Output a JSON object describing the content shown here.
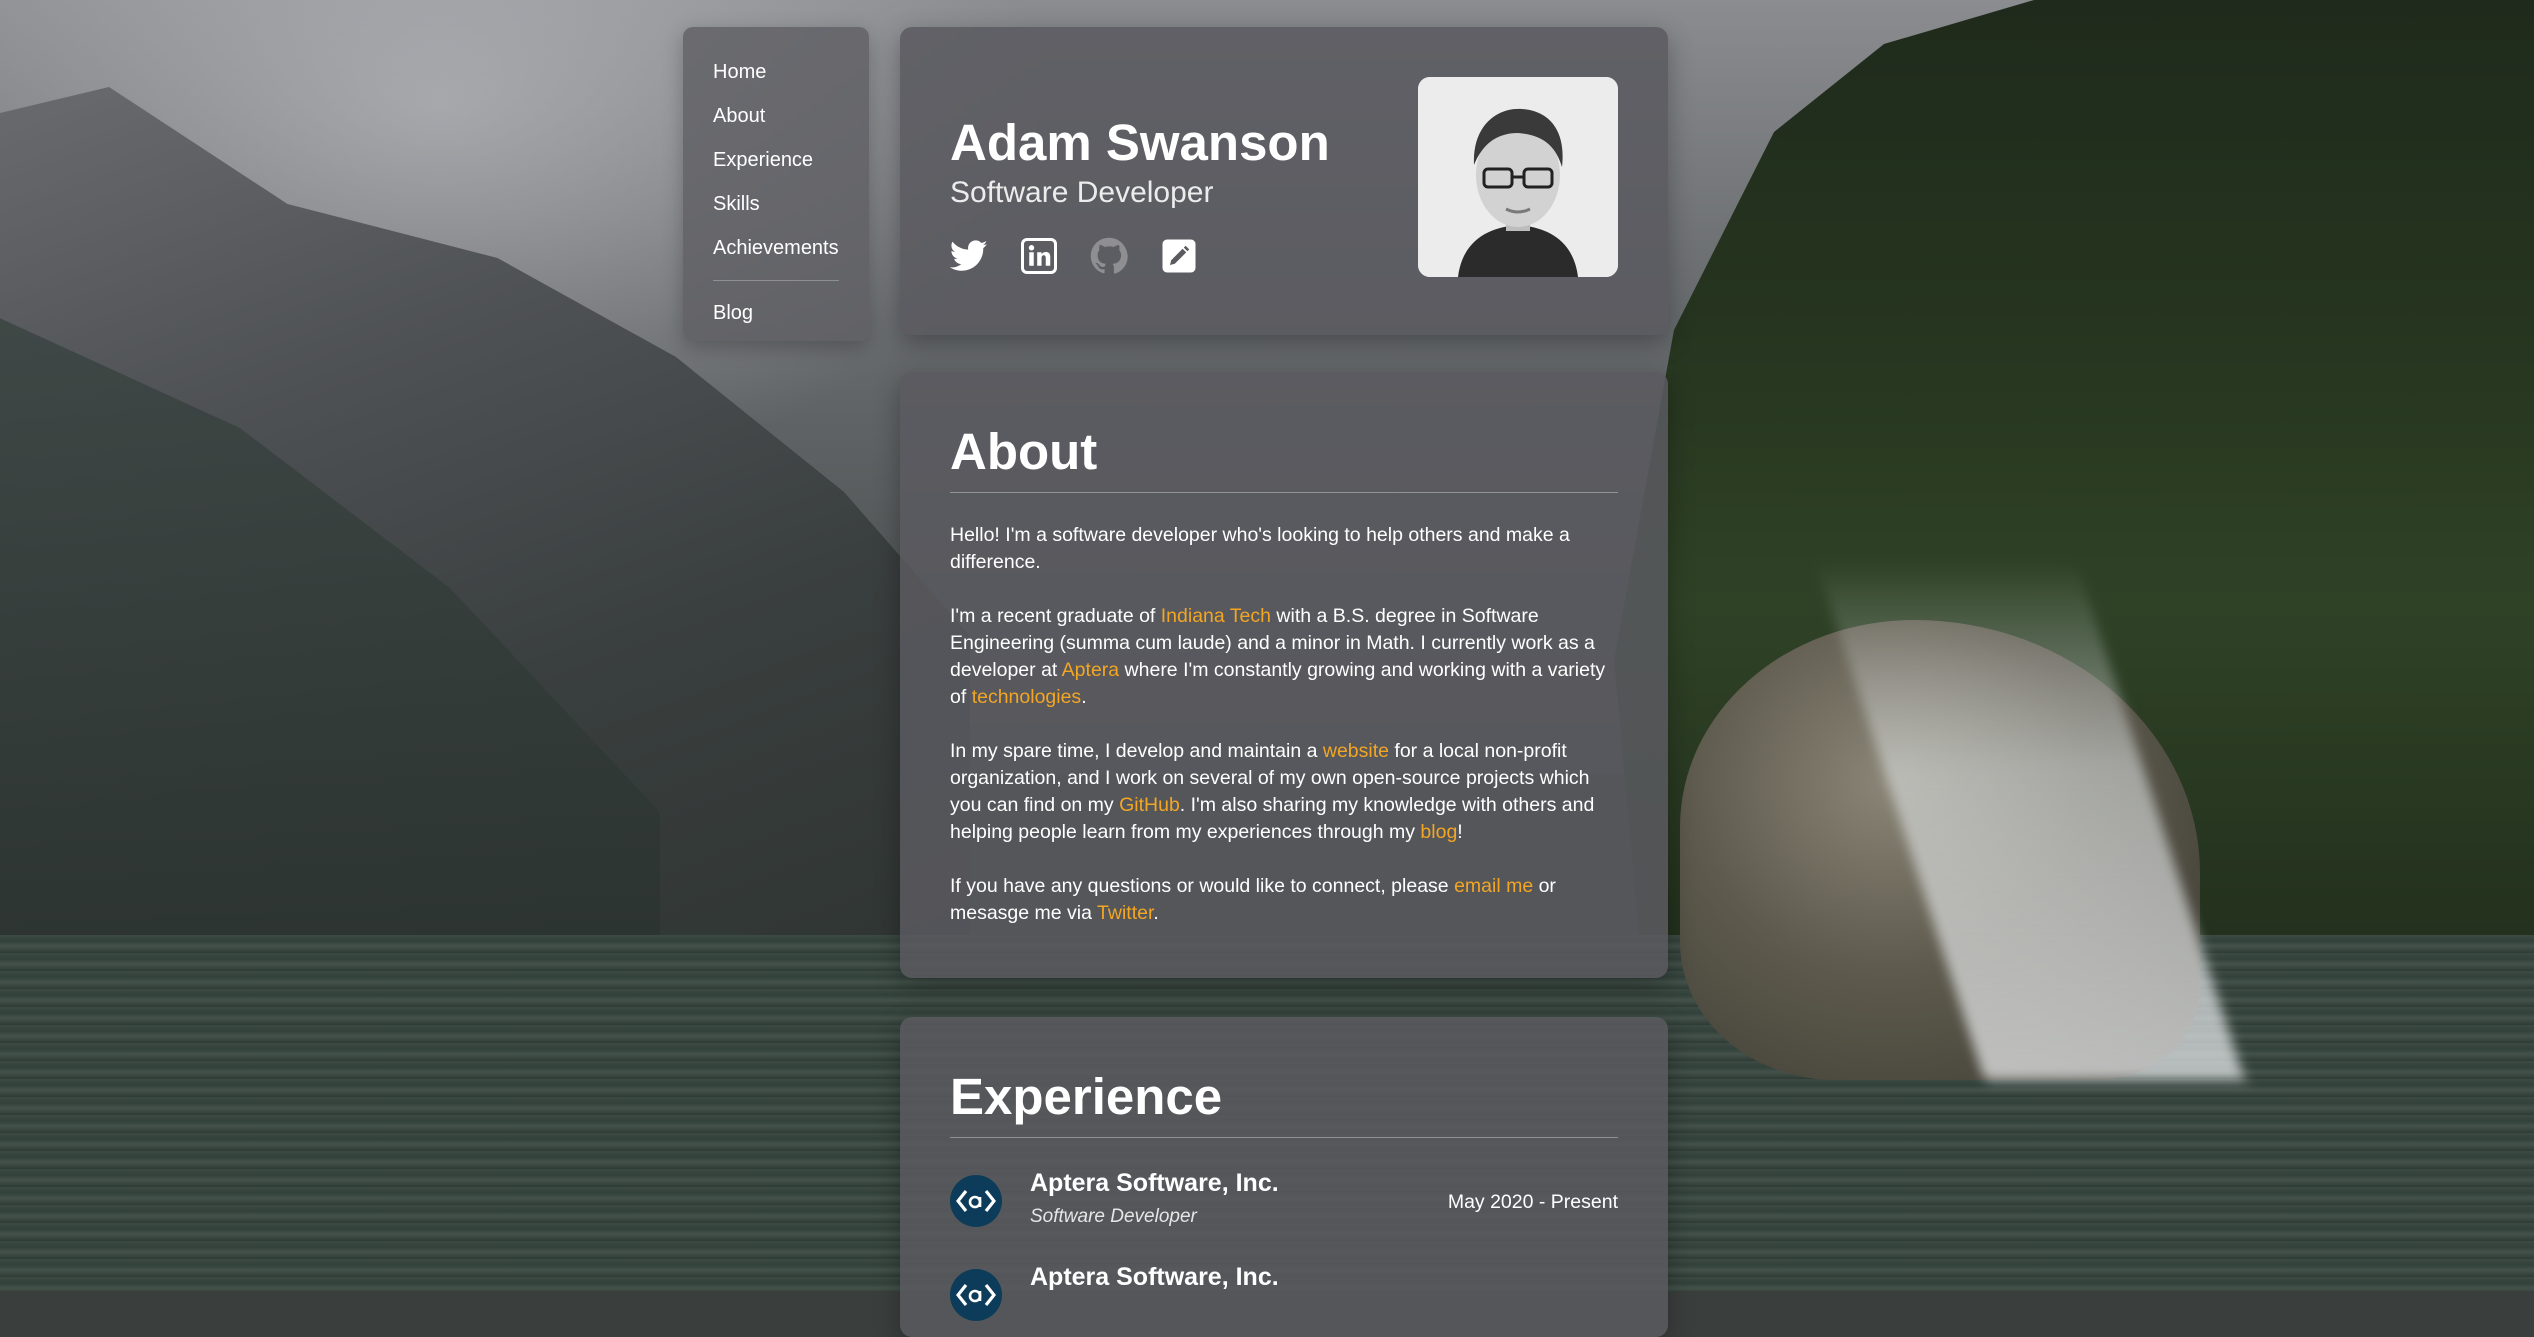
{
  "nav": {
    "items": [
      "Home",
      "About",
      "Experience",
      "Skills",
      "Achievements"
    ],
    "blog": "Blog"
  },
  "profile": {
    "name": "Adam Swanson",
    "role": "Software Developer",
    "socials": [
      "twitter-icon",
      "linkedin-icon",
      "github-icon",
      "blog-edit-icon"
    ]
  },
  "about": {
    "title": "About",
    "p1": "Hello! I'm a software developer who's looking to help others and make a difference.",
    "p2": {
      "t1": "I'm a recent graduate of ",
      "l1": "Indiana Tech",
      "t2": " with a B.S. degree in Software Engineering (summa cum laude) and a minor in Math. I currently work as a developer at ",
      "l2": "Aptera",
      "t3": " where I'm constantly growing and working with a variety of ",
      "l3": "technologies",
      "t4": "."
    },
    "p3": {
      "t1": "In my spare time, I develop and maintain a ",
      "l1": "website",
      "t2": " for a local non-profit organization, and I work on several of my own open-source projects which you can find on my ",
      "l2": "GitHub",
      "t3": ". I'm also sharing my knowledge with others and helping people learn from my experiences through my ",
      "l3": "blog",
      "t4": "!"
    },
    "p4": {
      "t1": "If you have any questions or would like to connect, please ",
      "l1": "email me",
      "t2": " or mesasge me via ",
      "l2": "Twitter",
      "t3": "."
    }
  },
  "experience": {
    "title": "Experience",
    "jobs": [
      {
        "company": "Aptera Software, Inc.",
        "title": "Software Developer",
        "dates": "May 2020 - Present"
      },
      {
        "company": "Aptera Software, Inc.",
        "title": "",
        "dates": ""
      }
    ]
  },
  "colors": {
    "link": "#f2a623",
    "card": "#5a5a5f"
  }
}
